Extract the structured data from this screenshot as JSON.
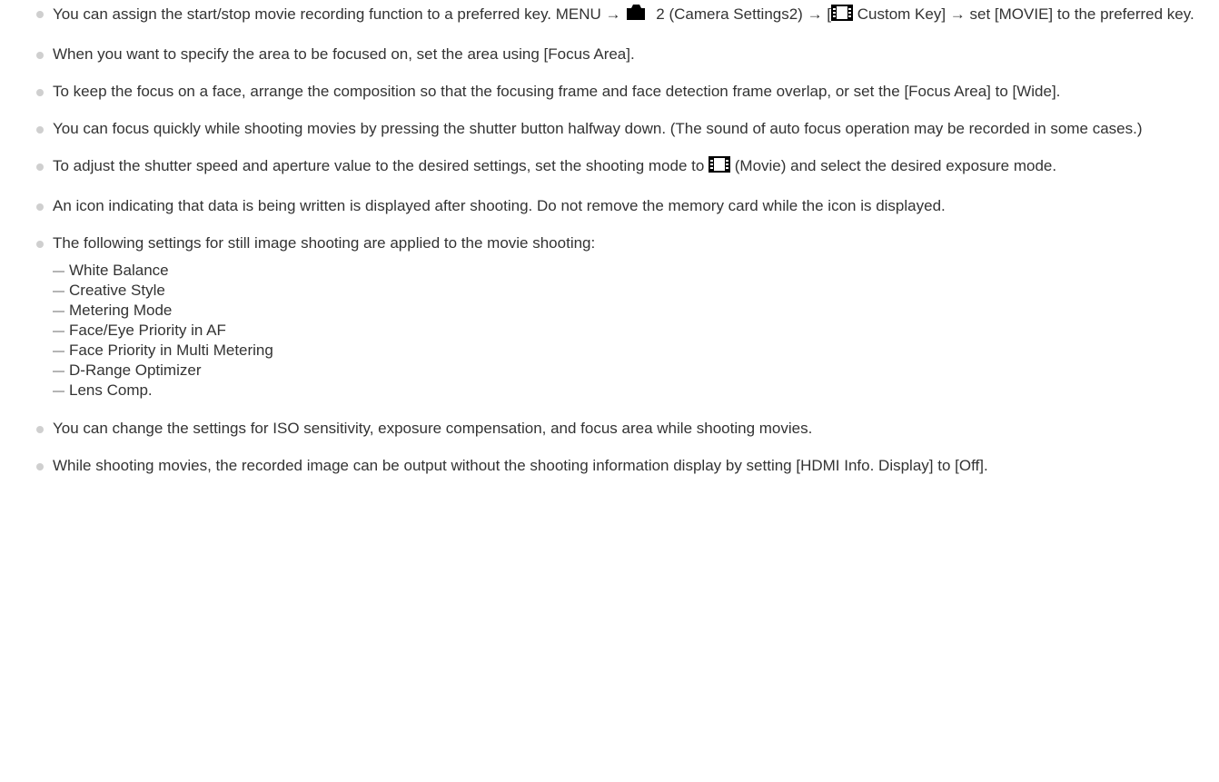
{
  "colors": {
    "text": "#333333",
    "bullet": "#cfcfcf",
    "dash": "#b5b5b5",
    "icon": "#000000"
  },
  "item1": {
    "part1": "You can assign the start/stop movie recording function to a preferred key. MENU → ",
    "camera_num": "2",
    "part2": " (Camera Settings2) → [",
    "part3": " Custom Key] → set [MOVIE] to the preferred key."
  },
  "item2": "When you want to specify the area to be focused on, set the area using [Focus Area].",
  "item3": "To keep the focus on a face, arrange the composition so that the focusing frame and face detection frame overlap, or set the [Focus Area] to [Wide].",
  "item4": "You can focus quickly while shooting movies by pressing the shutter button halfway down. (The sound of auto focus operation may be recorded in some cases.)",
  "item5": {
    "part1": "To adjust the shutter speed and aperture value to the desired settings, set the shooting mode to ",
    "part2": " (Movie) and select the desired exposure mode."
  },
  "item6": "An icon indicating that data is being written is displayed after shooting. Do not remove the memory card while the icon is displayed.",
  "item7": {
    "text": "The following settings for still image shooting are applied to the movie shooting:",
    "subitems": [
      "White Balance",
      "Creative Style",
      "Metering Mode",
      "Face/Eye Priority in AF",
      "Face Priority in Multi Metering",
      "D-Range Optimizer",
      "Lens Comp."
    ]
  },
  "item8": "You can change the settings for ISO sensitivity, exposure compensation, and focus area while shooting movies.",
  "item9": "While shooting movies, the recorded image can be output without the shooting information display by setting [HDMI Info. Display] to [Off].",
  "icons": {
    "camera": "camera-icon",
    "movie": "movie-film-icon"
  }
}
